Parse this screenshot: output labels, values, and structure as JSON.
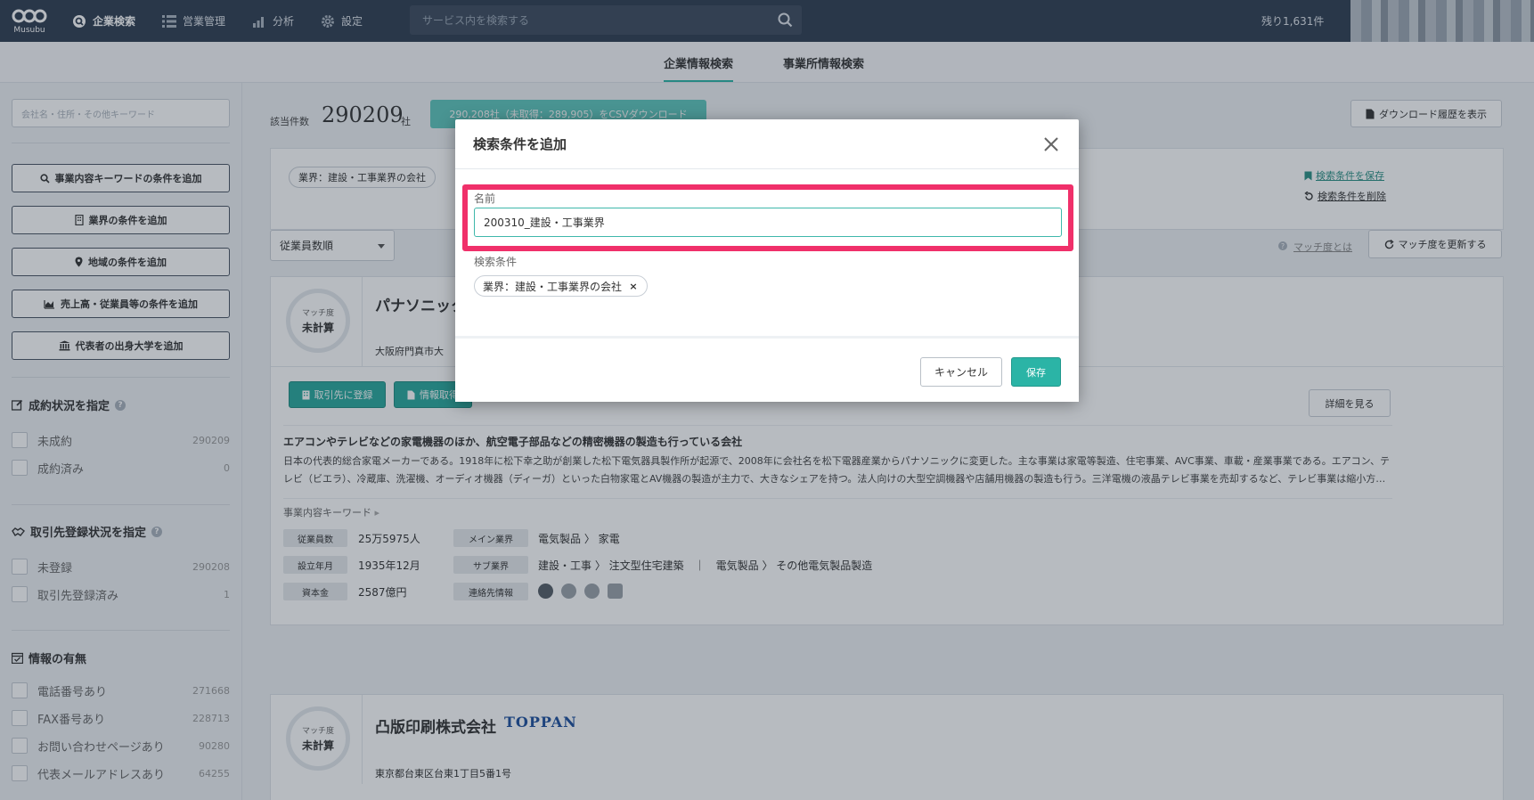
{
  "app": {
    "logo_text": "Musubu",
    "remaining": "残り1,631件"
  },
  "nav": {
    "items": [
      {
        "label": "企業検索",
        "icon": "search-company-icon"
      },
      {
        "label": "営業管理",
        "icon": "list-icon"
      },
      {
        "label": "分析",
        "icon": "bar-chart-icon"
      },
      {
        "label": "設定",
        "icon": "gear-icon"
      }
    ],
    "search_placeholder": "サービス内を検索する"
  },
  "subnav": {
    "tabs": [
      "企業情報検索",
      "事業所情報検索"
    ]
  },
  "sidebar": {
    "keyword_placeholder": "会社名・住所・その他キーワード",
    "buttons": [
      "事業内容キーワードの条件を追加",
      "業界の条件を追加",
      "地域の条件を追加",
      "売上高・従業員等の条件を追加",
      "代表者の出身大学を追加"
    ],
    "sections": [
      {
        "title": "成約状況を指定",
        "items": [
          {
            "label": "未成約",
            "count": "290209"
          },
          {
            "label": "成約済み",
            "count": "0"
          }
        ]
      },
      {
        "title": "取引先登録状況を指定",
        "items": [
          {
            "label": "未登録",
            "count": "290208"
          },
          {
            "label": "取引先登録済み",
            "count": "1"
          }
        ]
      },
      {
        "title": "情報の有無",
        "items": [
          {
            "label": "電話番号あり",
            "count": "271668"
          },
          {
            "label": "FAX番号あり",
            "count": "228713"
          },
          {
            "label": "お問い合わせページあり",
            "count": "90280"
          },
          {
            "label": "代表メールアドレスあり",
            "count": "64255"
          }
        ]
      }
    ]
  },
  "main": {
    "count_label": "該当件数",
    "count_value": "290209",
    "count_unit": "社",
    "csv_button": "290,208社（未取得：289,905）をCSVダウンロード",
    "download_history": "ダウンロード履歴を表示",
    "filter_tag": "業界：建設・工事業界の会社",
    "save_condition": "検索条件を保存",
    "delete_condition": "検索条件を削除",
    "sort": "従業員数順",
    "match_help": "マッチ度とは",
    "refresh_match": "マッチ度を更新する"
  },
  "cards": [
    {
      "match_label": "マッチ度",
      "match_value": "未計算",
      "name": "パナソニック",
      "address": "大阪府門真市大",
      "register_button": "取引先に登録",
      "info_button": "情報取得",
      "detail_button": "詳細を見る",
      "desc_title": "エアコンやテレビなどの家電機器のほか、航空電子部品などの精密機器の製造も行っている会社",
      "desc_body": "日本の代表的総合家電メーカーである。1918年に松下幸之助が創業した松下電気器具製作所が起源で、2008年に会社名を松下電器産業からパナソニックに変更した。主な事業は家電等製造、住宅事業、AVC事業、車載・産業事業である。エアコン、テレビ（ビエラ）、冷蔵庫、洗濯機、オーディオ機器（ディーガ）といった白物家電とAV機器の製造が主力で、大きなシェアを持つ。法人向けの大型空調機器や店舗用機器の製造も行う。三洋電機の液晶テレビ事業を売却するなど、テレビ事業は縮小方…",
      "keyword_label": "事業内容キーワード",
      "employees_label": "従業員数",
      "employees": "25万5975人",
      "founded_label": "設立年月",
      "founded": "1935年12月",
      "capital_label": "資本金",
      "capital": "2587億円",
      "main_industry_label": "メイン業界",
      "main_industry": "電気製品 〉 家電",
      "sub_industry_label": "サブ業界",
      "sub_industry": "建設・工事 〉 注文型住宅建築　｜　電気製品 〉 その他電気製品製造",
      "contact_label": "連絡先情報"
    },
    {
      "match_label": "マッチ度",
      "match_value": "未計算",
      "name": "凸版印刷株式会社",
      "logo_text": "TOPPAN",
      "address": "東京都台東区台東1丁目5番1号"
    }
  ],
  "modal": {
    "title": "検索条件を追加",
    "name_label": "名前",
    "name_value": "200310_建設・工事業界",
    "condition_label": "検索条件",
    "condition_chip": "業界：建設・工事業界の会社",
    "cancel": "キャンセル",
    "save": "保存"
  },
  "colors": {
    "accent": "#2bb4a6",
    "header": "#2f3d50",
    "highlight": "#f0306a"
  }
}
